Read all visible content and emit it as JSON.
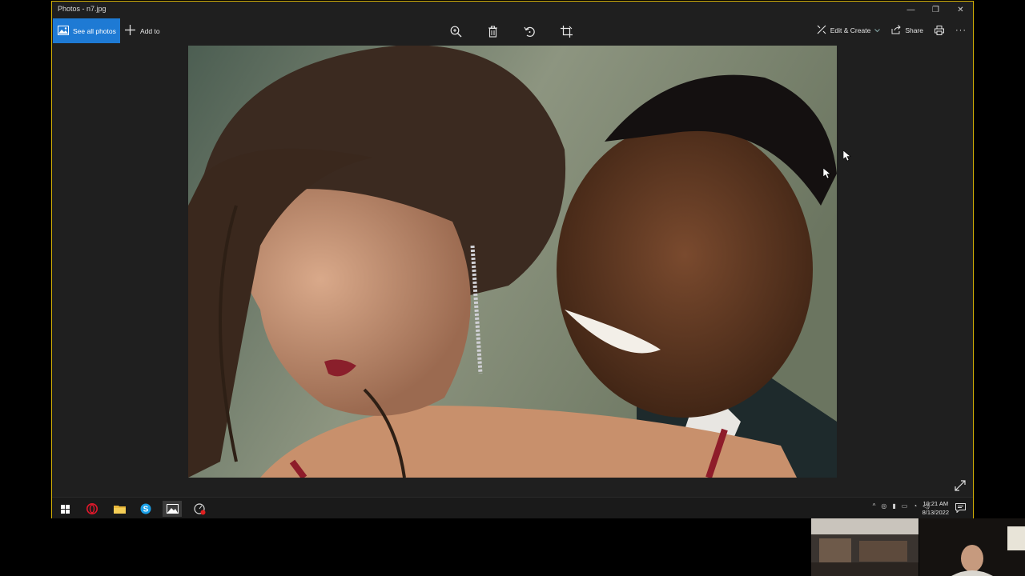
{
  "window": {
    "title": "Photos - n7.jpg",
    "controls": {
      "minimize": "—",
      "restore": "❐",
      "close": "✕"
    }
  },
  "toolbar": {
    "see_all_label": "See all photos",
    "add_to_label": "Add to",
    "edit_create_label": "Edit & Create",
    "share_label": "Share",
    "more_label": "···"
  },
  "icons": {
    "zoom": "zoom-icon",
    "delete": "trash-icon",
    "rotate": "rotate-icon",
    "crop": "crop-icon",
    "print": "print-icon",
    "expand": "expand-icon"
  },
  "colors": {
    "accent": "#1e7ad4",
    "window_border": "#d4b106",
    "background": "#1f1f1f"
  },
  "taskbar": {
    "time": "10:21 AM",
    "date": "8/13/2022",
    "tray_chevron": "^"
  }
}
